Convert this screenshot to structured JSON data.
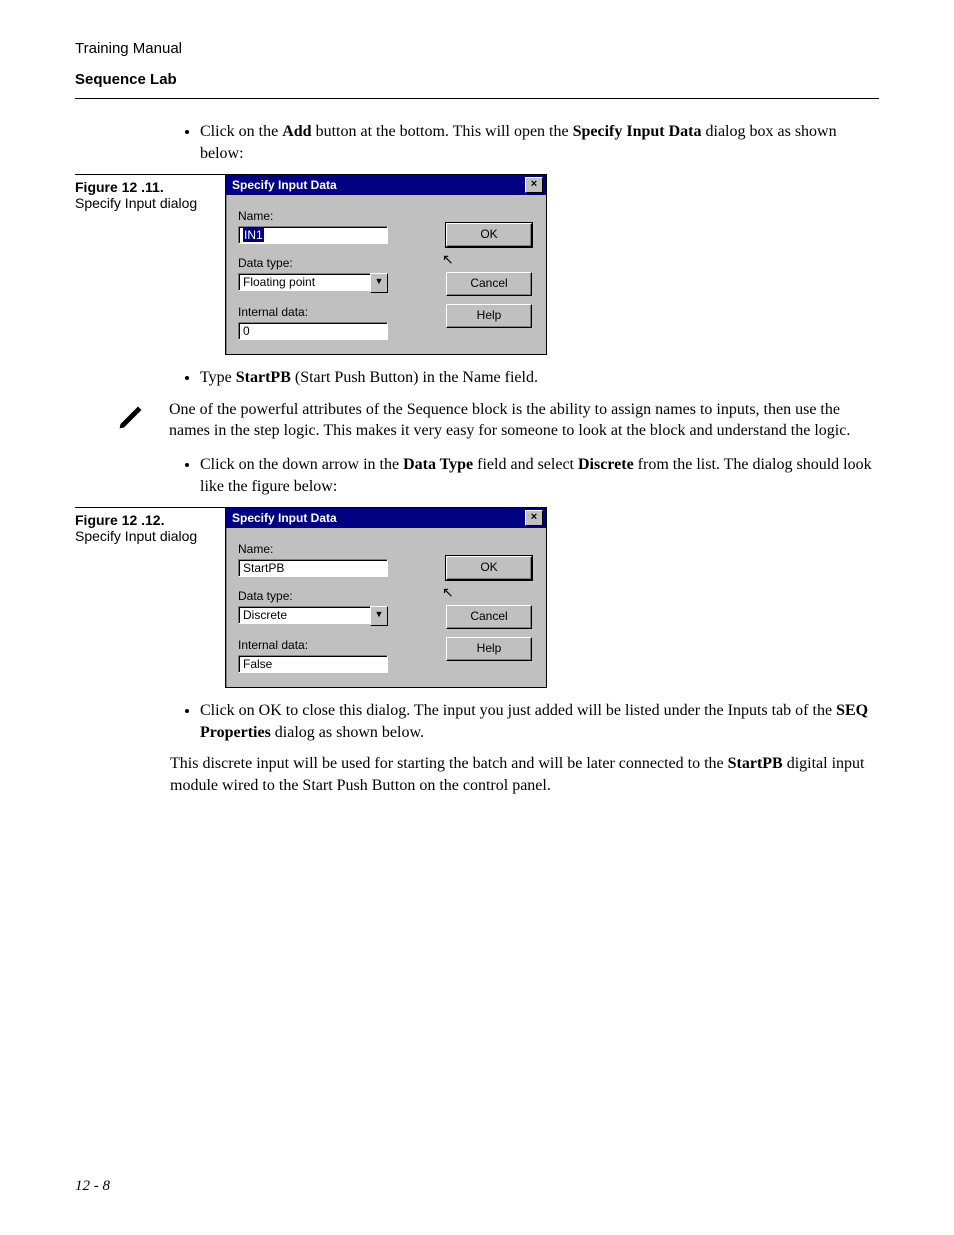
{
  "header": {
    "line1": "Training Manual",
    "line2": "Sequence Lab"
  },
  "bullets": {
    "b1_pre": "Click on the ",
    "b1_bold1": "Add",
    "b1_mid": " button at the bottom. This will open the ",
    "b1_bold2": "Specify Input Data",
    "b1_post": " dialog box as shown below:",
    "b2_pre": "Type ",
    "b2_bold": "StartPB",
    "b2_post": "  (Start Push Button) in the Name field.",
    "b3_pre": "Click on the down arrow in the ",
    "b3_bold1": "Data Type",
    "b3_mid": " field and select ",
    "b3_bold2": "Discrete",
    "b3_post": " from the list. The dialog should look like the figure below:",
    "b4_pre": "Click on OK to close this dialog. The input you just added will be listed under the Inputs tab of the ",
    "b4_bold": "SEQ Properties",
    "b4_post": " dialog as shown below."
  },
  "note": "One of the powerful attributes of the Sequence block is the ability to assign names to inputs, then use the names in the step logic.  This makes it very easy for someone to look at the block and understand the logic.",
  "trailing_pre": "This discrete input will be used for starting the batch and will be later connected to the ",
  "trailing_bold": "StartPB",
  "trailing_post": " digital input module wired to the Start Push Button on the control panel.",
  "fig11": {
    "num": "Figure 12 .11.",
    "cap": "Specify Input dialog"
  },
  "fig12": {
    "num": "Figure 12 .12.",
    "cap": "Specify Input dialog"
  },
  "dialog_common": {
    "title": "Specify Input Data",
    "labels": {
      "name": "Name:",
      "datatype": "Data type:",
      "internal": "Internal data:"
    },
    "buttons": {
      "ok": "OK",
      "cancel": "Cancel",
      "help": "Help"
    }
  },
  "dialog1": {
    "name_value": "IN1",
    "datatype_value": "Floating point",
    "internal_value": "0"
  },
  "dialog2": {
    "name_value": "StartPB",
    "datatype_value": "Discrete",
    "internal_value": "False"
  },
  "pagefoot": "12 - 8"
}
